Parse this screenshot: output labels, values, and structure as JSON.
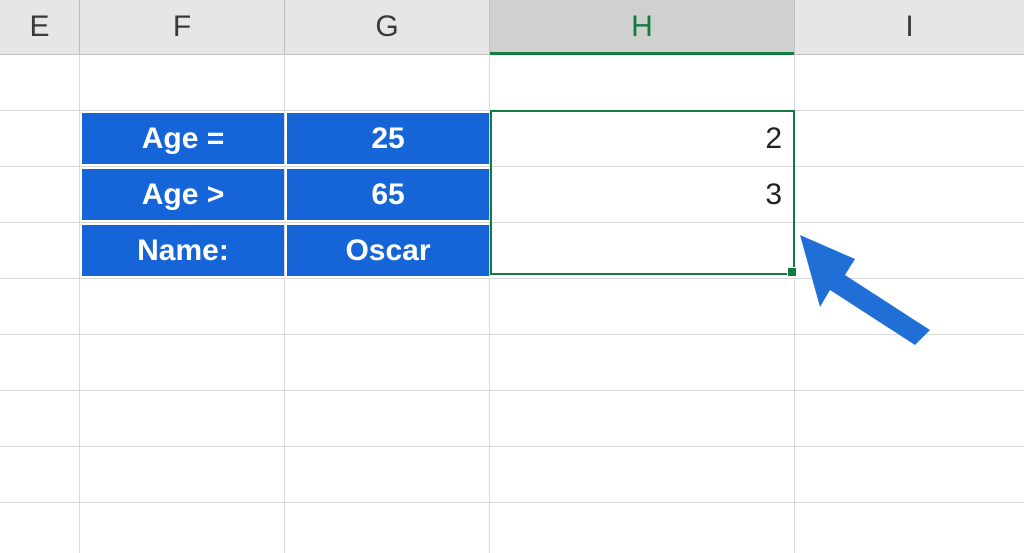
{
  "columns": {
    "E": "E",
    "F": "F",
    "G": "G",
    "H": "H",
    "I": "I"
  },
  "selected_column": "H",
  "criteria": [
    {
      "label": "Age =",
      "value": "25",
      "result": "2"
    },
    {
      "label": "Age >",
      "value": "65",
      "result": "3"
    },
    {
      "label": "Name:",
      "value": "Oscar",
      "result": ""
    }
  ],
  "colors": {
    "fill": "#1565d8",
    "selection": "#107c41"
  }
}
